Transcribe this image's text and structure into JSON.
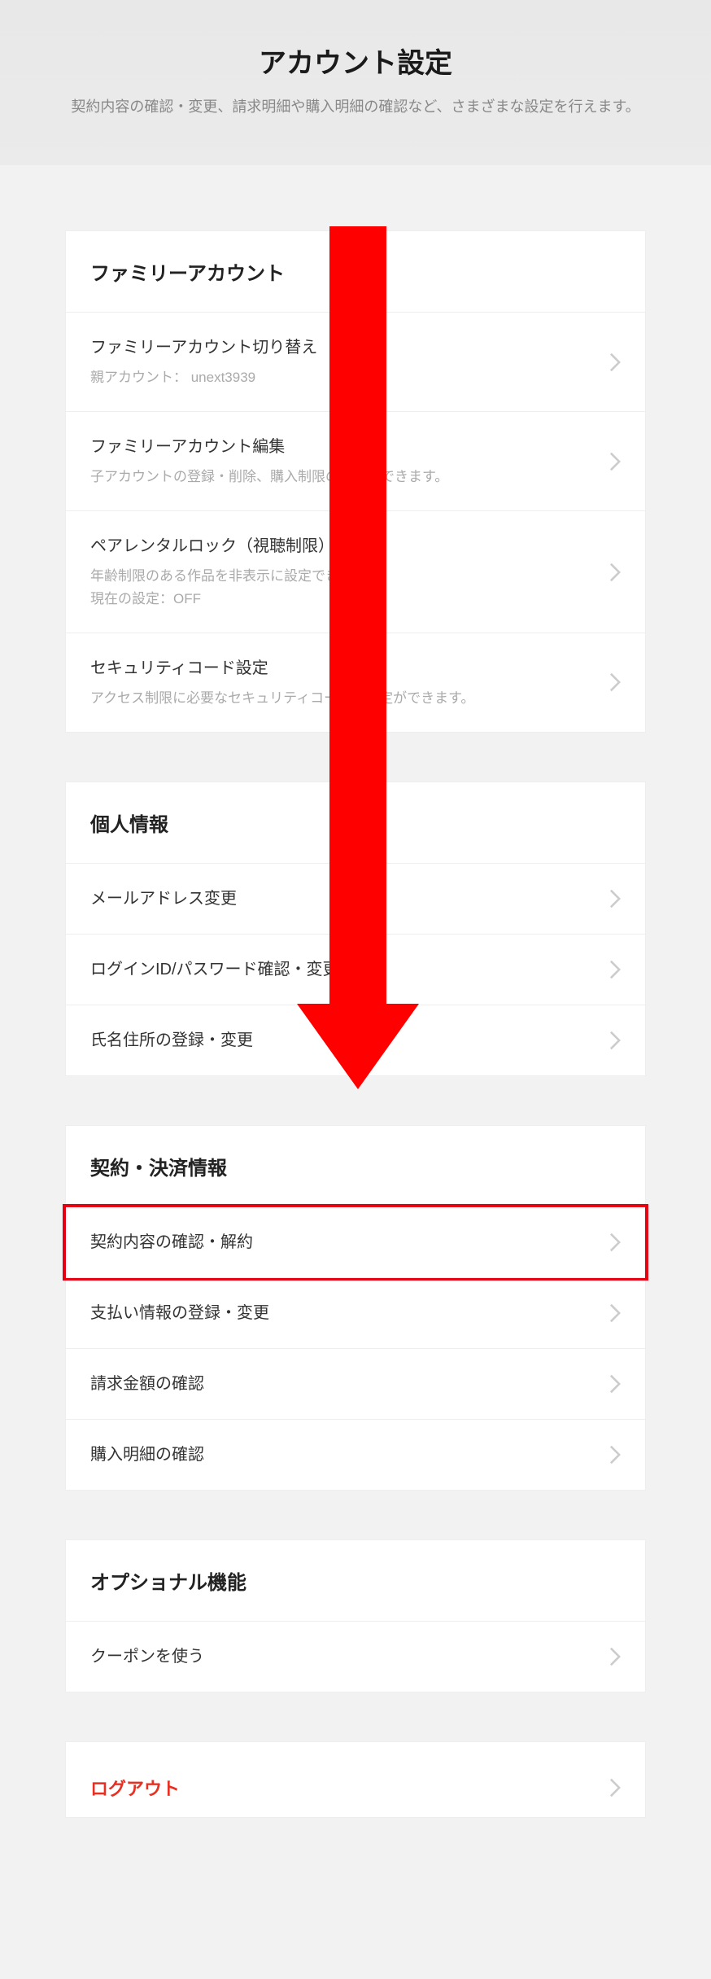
{
  "header": {
    "title": "アカウント設定",
    "subtitle": "契約内容の確認・変更、請求明細や購入明細の確認など、さまざまな設定を行えます。"
  },
  "sections": {
    "family": {
      "title": "ファミリーアカウント",
      "items": [
        {
          "title": "ファミリーアカウント切り替え",
          "sub": "親アカウント： unext3939"
        },
        {
          "title": "ファミリーアカウント編集",
          "sub": "子アカウントの登録・削除、購入制限の設定ができます。"
        },
        {
          "title": "ペアレンタルロック（視聴制限）",
          "sub": "年齢制限のある作品を非表示に設定できます。\n現在の設定：OFF"
        },
        {
          "title": "セキュリティコード設定",
          "sub": "アクセス制限に必要なセキュリティコードの設定ができます。"
        }
      ]
    },
    "personal": {
      "title": "個人情報",
      "items": [
        {
          "title": "メールアドレス変更"
        },
        {
          "title": "ログインID/パスワード確認・変更"
        },
        {
          "title": "氏名住所の登録・変更"
        }
      ]
    },
    "contract": {
      "title": "契約・決済情報",
      "items": [
        {
          "title": "契約内容の確認・解約",
          "highlighted": true
        },
        {
          "title": "支払い情報の登録・変更"
        },
        {
          "title": "請求金額の確認"
        },
        {
          "title": "購入明細の確認"
        }
      ]
    },
    "optional": {
      "title": "オプショナル機能",
      "items": [
        {
          "title": "クーポンを使う"
        }
      ]
    }
  },
  "logout": {
    "label": "ログアウト"
  }
}
